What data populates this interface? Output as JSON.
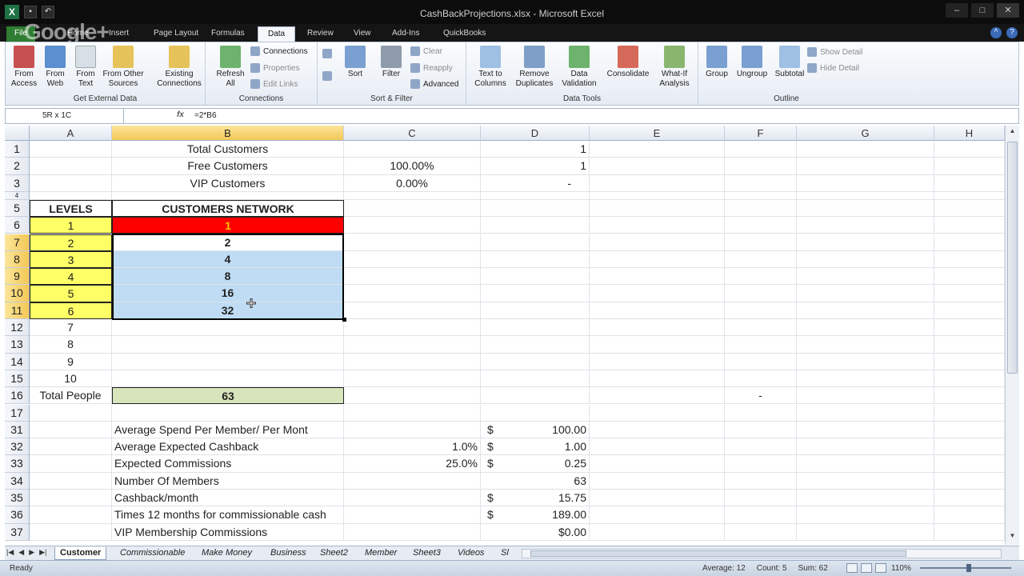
{
  "window": {
    "title": "CashBackProjections.xlsx - Microsoft Excel",
    "watermark": "Google+",
    "colors": {
      "ribbon_bg": "#e6ecf4",
      "header_selected": "#f3c856",
      "level_fill": "#ffff66",
      "top_cell_fill": "#ff0000",
      "selected_fill": "#bfdcf4",
      "total_fill": "#d8e4bc"
    }
  },
  "tabs": {
    "file": "File",
    "home": "Home",
    "insert": "Insert",
    "page_layout": "Page Layout",
    "formulas": "Formulas",
    "data": "Data",
    "review": "Review",
    "view": "View",
    "addins": "Add-Ins",
    "quickbooks": "QuickBooks"
  },
  "ribbon": {
    "get_external": {
      "label": "Get External Data",
      "access": "From Access",
      "web": "From Web",
      "text": "From Text",
      "other": "From Other Sources",
      "existing": "Existing Connections"
    },
    "connections": {
      "label": "Connections",
      "refresh": "Refresh All",
      "connections": "Connections",
      "properties": "Properties",
      "edit_links": "Edit Links"
    },
    "sort_filter": {
      "label": "Sort & Filter",
      "sort": "Sort",
      "filter": "Filter",
      "clear": "Clear",
      "reapply": "Reapply",
      "advanced": "Advanced"
    },
    "data_tools": {
      "label": "Data Tools",
      "text_to_columns": "Text to Columns",
      "remove_duplicates": "Remove Duplicates",
      "data_validation": "Data Validation",
      "consolidate": "Consolidate",
      "what_if": "What-If Analysis"
    },
    "outline": {
      "label": "Outline",
      "group": "Group",
      "ungroup": "Ungroup",
      "subtotal": "Subtotal",
      "show_detail": "Show Detail",
      "hide_detail": "Hide Detail"
    }
  },
  "formula_bar": {
    "name_box": "5R x 1C",
    "fx": "fx",
    "formula": "=2*B6"
  },
  "columns": [
    "A",
    "B",
    "C",
    "D",
    "E",
    "F",
    "G",
    "H"
  ],
  "rows": [
    {
      "n": "1",
      "b": "Total Customers",
      "d": "1"
    },
    {
      "n": "2",
      "b": "Free Customers",
      "c": "100.00%",
      "d": "1"
    },
    {
      "n": "3",
      "b": "VIP Customers",
      "c": "0.00%",
      "d": "-"
    },
    {
      "n": "4"
    },
    {
      "n": "5",
      "a": "LEVELS",
      "b": "CUSTOMERS NETWORK"
    },
    {
      "n": "6",
      "a": "1",
      "b": "1"
    },
    {
      "n": "7",
      "a": "2",
      "b": "2"
    },
    {
      "n": "8",
      "a": "3",
      "b": "4"
    },
    {
      "n": "9",
      "a": "4",
      "b": "8"
    },
    {
      "n": "10",
      "a": "5",
      "b": "16"
    },
    {
      "n": "11",
      "a": "6",
      "b": "32"
    },
    {
      "n": "12",
      "a": "7"
    },
    {
      "n": "13",
      "a": "8"
    },
    {
      "n": "14",
      "a": "9"
    },
    {
      "n": "15",
      "a": "10"
    },
    {
      "n": "16",
      "a": "Total People",
      "b": "63",
      "f": "-"
    },
    {
      "n": "17"
    },
    {
      "n": "31",
      "b": "Average Spend Per Member/ Per Mont",
      "dl": "$",
      "d": "100.00"
    },
    {
      "n": "32",
      "b": "Average Expected Cashback",
      "c": "1.0%",
      "dl": "$",
      "d": "1.00"
    },
    {
      "n": "33",
      "b": "Expected Commissions",
      "c": "25.0%",
      "dl": "$",
      "d": "0.25"
    },
    {
      "n": "34",
      "b": "Number Of Members",
      "d": "63"
    },
    {
      "n": "35",
      "b": "Cashback/month",
      "dl": "$",
      "d": "15.75"
    },
    {
      "n": "36",
      "b": "Times 12 months for commissionable cash",
      "dl": "$",
      "d": "189.00"
    },
    {
      "n": "37",
      "b": "VIP Membership Commissions",
      "d": "$0.00"
    }
  ],
  "sheet_tabs": [
    "Customer",
    "Commissionable",
    "Make Money",
    "Business",
    "Sheet2",
    "Member",
    "Sheet3",
    "Videos",
    "Sl"
  ],
  "status": {
    "ready": "Ready",
    "average": "Average: 12",
    "count": "Count: 5",
    "sum": "Sum: 62",
    "zoom": "110%"
  }
}
